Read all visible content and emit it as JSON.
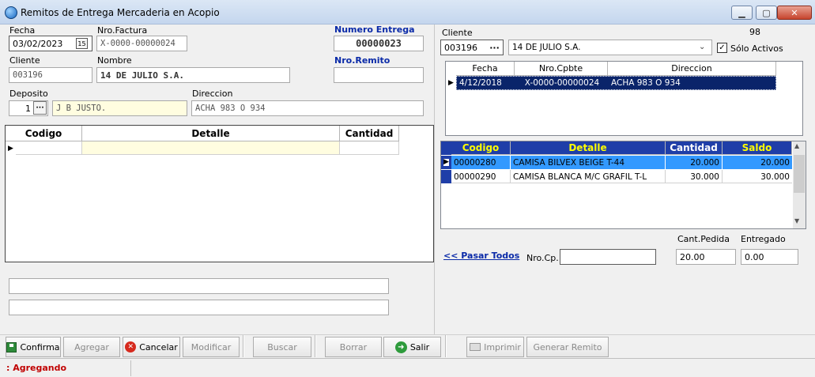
{
  "window": {
    "title": "Remitos de Entrega Mercaderia en Acopio"
  },
  "left": {
    "fecha_label": "Fecha",
    "fecha_value": "03/02/2023",
    "calendar_glyph": "15",
    "nrofactura_label": "Nro.Factura",
    "nrofactura_value": "X-0000-00000024",
    "numero_entrega_label": "Numero Entrega",
    "numero_entrega_value": "00000023",
    "cliente_label": "Cliente",
    "cliente_value": "003196",
    "nombre_label": "Nombre",
    "nombre_value": "14 DE JULIO S.A.",
    "nroremito_label": "Nro.Remito",
    "nroremito_value": "",
    "deposito_label": "Deposito",
    "deposito_value": "1",
    "deposito_name": "J B JUSTO.",
    "direccion_label": "Direccion",
    "direccion_value": "ACHA 983 O 934",
    "detail_grid": {
      "headers": [
        "Codigo",
        "Detalle",
        "Cantidad"
      ]
    },
    "obs1": "",
    "obs2": ""
  },
  "right": {
    "cliente_label": "Cliente",
    "count": "98",
    "cliente_code": "003196",
    "cliente_name": "14 DE JULIO S.A.",
    "solo_activos_label": "Sólo Activos",
    "solo_activos_checked": true,
    "comprobantes": {
      "headers": [
        "Fecha",
        "Nro.Cpbte",
        "Direccion"
      ],
      "rows": [
        {
          "fecha": "4/12/2018",
          "nro": "X-0000-00000024",
          "direccion": "ACHA 983 O 934"
        }
      ]
    },
    "items": {
      "headers": [
        "Codigo",
        "Detalle",
        "Cantidad",
        "Saldo"
      ],
      "rows": [
        {
          "codigo": "00000280",
          "detalle": "CAMISA BILVEX BEIGE T-44",
          "cantidad": "20.000",
          "saldo": "20.000"
        },
        {
          "codigo": "00000290",
          "detalle": "CAMISA BLANCA M/C GRAFIL T-L",
          "cantidad": "30.000",
          "saldo": "30.000"
        }
      ]
    },
    "pasar_todos": "<< Pasar Todos",
    "nrocp_label": "Nro.Cp.",
    "nrocp_value": "",
    "cant_pedida_label": "Cant.Pedida",
    "cant_pedida_value": "20.00",
    "entregado_label": "Entregado",
    "entregado_value": "0.00"
  },
  "toolbar": {
    "confirma": "Confirma",
    "agregar": "Agregar",
    "cancelar": "Cancelar",
    "modificar": "Modificar",
    "buscar": "Buscar",
    "borrar": "Borrar",
    "salir": "Salir",
    "imprimir": "Imprimir",
    "generar_remito": "Generar Remito"
  },
  "status": {
    "text": ": Agregando"
  },
  "colors": {
    "header_blue": "#1f3ea8",
    "selection": "#0a246a",
    "highlight_row": "#3399ff",
    "header_text_yellow": "#ffff00",
    "status_red": "#c00000"
  }
}
